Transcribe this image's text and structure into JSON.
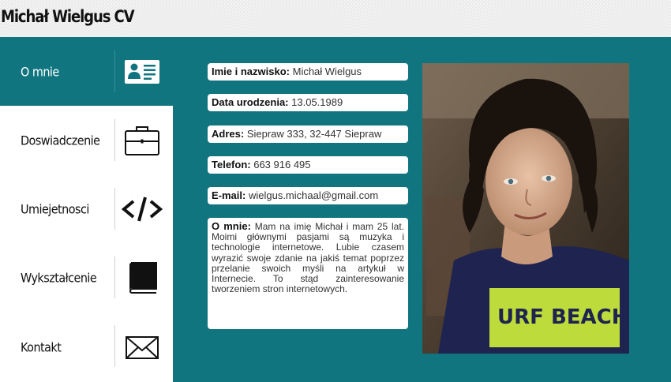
{
  "header": {
    "title": "Michał Wielgus CV"
  },
  "nav": [
    {
      "label": "O mnie",
      "icon": "id-card-icon",
      "active": true
    },
    {
      "label": "Doswiadczenie",
      "icon": "briefcase-icon",
      "active": false
    },
    {
      "label": "Umiejetnosci",
      "icon": "code-icon",
      "active": false
    },
    {
      "label": "Wykształcenie",
      "icon": "book-icon",
      "active": false
    },
    {
      "label": "Kontakt",
      "icon": "envelope-icon",
      "active": false
    }
  ],
  "profile": {
    "name_label": "Imie i nazwisko:",
    "name_value": "Michał Wielgus",
    "birth_label": "Data urodzenia:",
    "birth_value": "13.05.1989",
    "address_label": "Adres:",
    "address_value": "Siepraw 333, 32-447 Siepraw",
    "phone_label": "Telefon:",
    "phone_value": "663 916 495",
    "email_label": "E-mail:",
    "email_value": "wielgus.michaal@gmail.com",
    "about_label": "O mnie:",
    "about_value": "Mam na imię Michał i mam 25 lat. Moimi głównymi pasjami są muzyka i technologie internetowe. Lubie czasem wyrazić swoje zdanie na jakiś temat poprzez przelanie swoich myśli na artykuł w Internecie. To stąd zainteresowanie tworzeniem stron internetowych."
  },
  "photo": {
    "shirt_text": "URF BEACH"
  },
  "colors": {
    "teal": "#117580",
    "white": "#ffffff",
    "text": "#111111"
  }
}
